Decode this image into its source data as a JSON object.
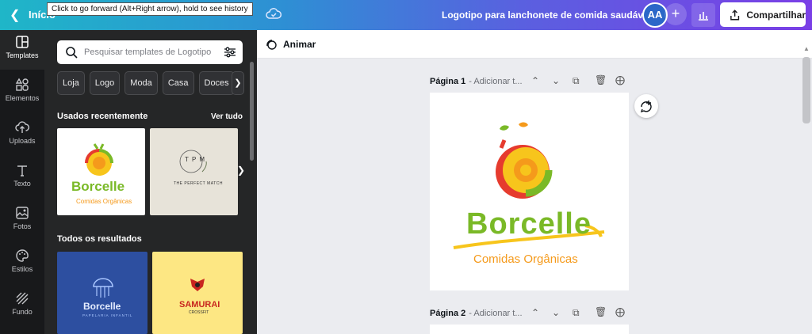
{
  "topbar": {
    "home_label": "Início",
    "tooltip": "Click to go forward (Alt+Right arrow), hold to see history",
    "doc_title": "Logotipo para lanchonete de comida saudável",
    "avatar": "AA",
    "share_label": "Compartilhar"
  },
  "rail": {
    "items": [
      {
        "label": "Templates",
        "icon": "templates-icon"
      },
      {
        "label": "Elementos",
        "icon": "elements-icon"
      },
      {
        "label": "Uploads",
        "icon": "upload-icon"
      },
      {
        "label": "Texto",
        "icon": "text-icon"
      },
      {
        "label": "Fotos",
        "icon": "photos-icon"
      },
      {
        "label": "Estilos",
        "icon": "palette-icon"
      },
      {
        "label": "Fundo",
        "icon": "background-icon"
      }
    ]
  },
  "panel": {
    "search_placeholder": "Pesquisar templates de Logotipo",
    "chips": [
      "Loja",
      "Logo",
      "Moda",
      "Casa",
      "Doces"
    ],
    "recent_title": "Usados recentemente",
    "see_all": "Ver tudo",
    "all_results_title": "Todos os resultados",
    "recent": [
      {
        "brand": "Borcelle",
        "sub": "Comidas Orgânicas"
      },
      {
        "brand": "T P M",
        "sub": "THE PERFECT MATCH"
      }
    ],
    "results": [
      {
        "brand": "Borcelle",
        "sub": "PAPELARIA INFANTIL"
      },
      {
        "brand": "SAMURAI",
        "sub": "CROSSFIT"
      }
    ]
  },
  "editor": {
    "animate_label": "Animar",
    "page1_label": "Página 1",
    "page1_sub": "- Adicionar t...",
    "page2_label": "Página 2",
    "page2_sub": "- Adicionar t...",
    "logo_brand": "Borcelle",
    "logo_sub": "Comidas Orgânicas"
  },
  "colors": {
    "logo_green": "#7ab927",
    "logo_orange": "#f59a1b",
    "logo_red": "#e63b2e",
    "logo_yellow": "#f7c51c"
  }
}
